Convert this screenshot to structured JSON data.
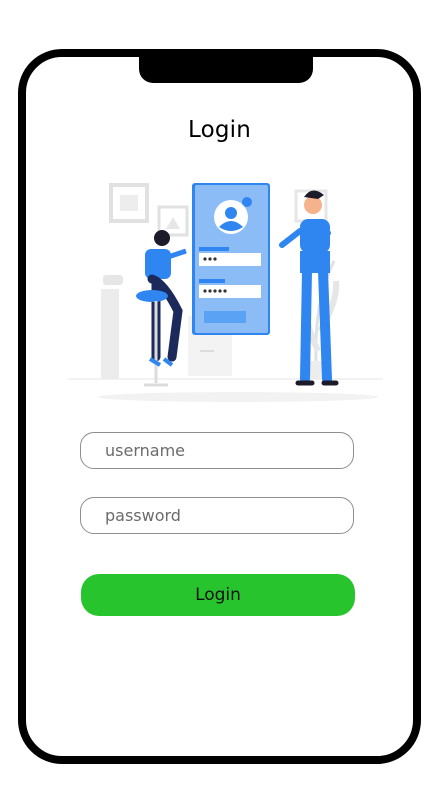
{
  "header": {
    "title": "Login"
  },
  "form": {
    "username": {
      "value": "",
      "placeholder": "username"
    },
    "password": {
      "value": "",
      "placeholder": "password"
    },
    "login_label": "Login"
  },
  "colors": {
    "button": "#27c42e",
    "accent_blue": "#2f86f0",
    "frame": "#000000"
  },
  "illustration": {
    "icons": [
      "user-avatar-icon",
      "password-dots-icon",
      "person-icon",
      "plant-icon",
      "picture-frame-icon"
    ]
  }
}
